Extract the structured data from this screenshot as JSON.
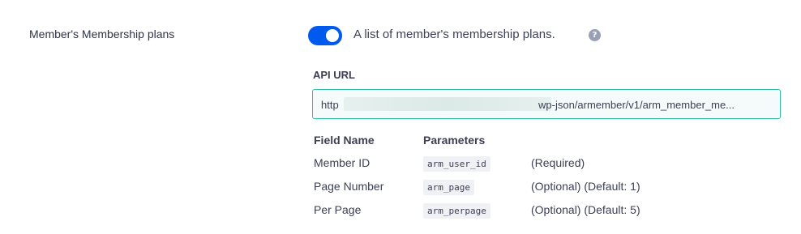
{
  "setting": {
    "label": "Member's Membership plans",
    "toggle_on": true,
    "description": "A list of member's membership plans.",
    "help_icon": "question-circle-icon"
  },
  "api": {
    "label": "API URL",
    "prefix": "http",
    "suffix": "wp-json/armember/v1/arm_member_me..."
  },
  "params_table": {
    "headers": [
      "Field Name",
      "Parameters"
    ],
    "rows": [
      {
        "field": "Member ID",
        "param": "arm_user_id",
        "note": "(Required)"
      },
      {
        "field": "Page Number",
        "param": "arm_page",
        "note": "(Optional) (Default: 1)"
      },
      {
        "field": "Per Page",
        "param": "arm_perpage",
        "note": "(Optional) (Default: 5)"
      }
    ]
  },
  "colors": {
    "toggle": "#005aee",
    "input_border": "#2fbfa0"
  }
}
